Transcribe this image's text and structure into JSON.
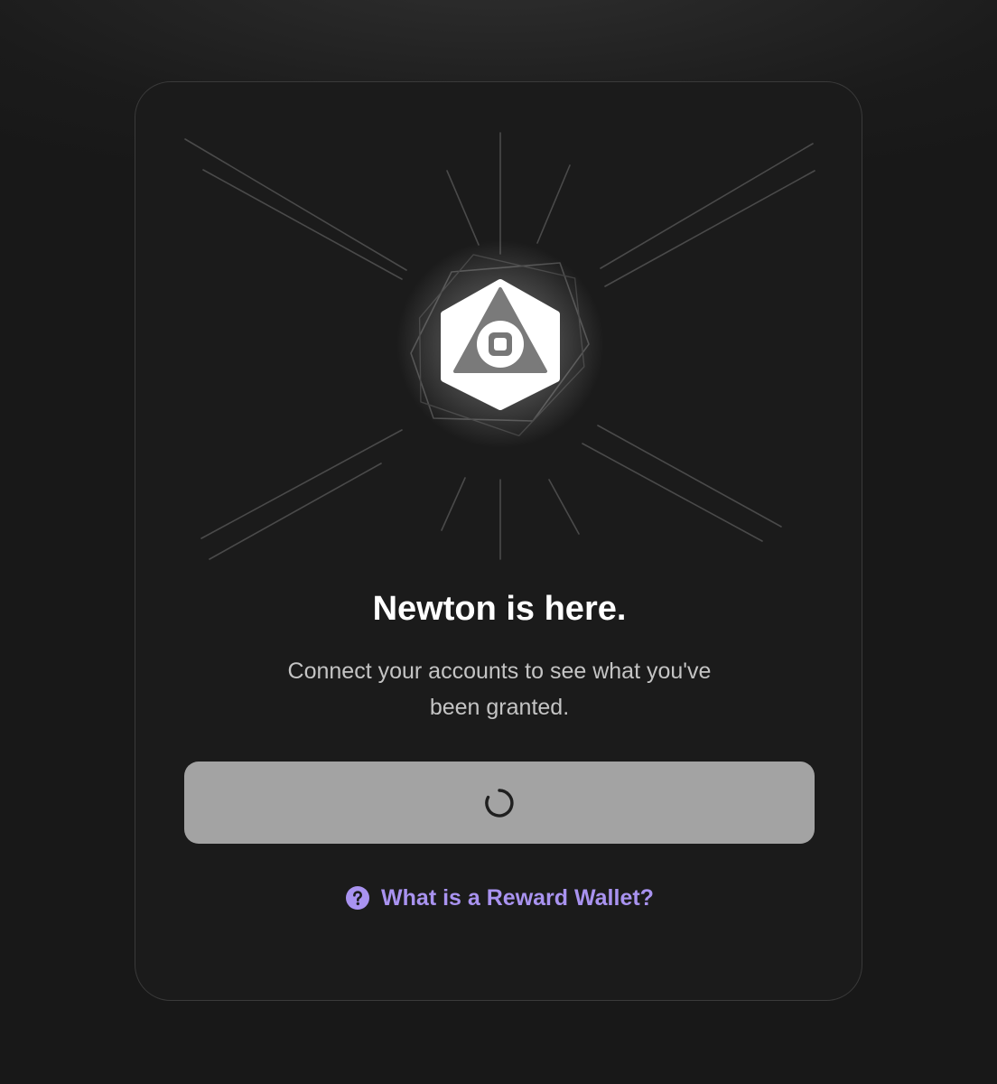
{
  "onboarding": {
    "title": "Newton is here.",
    "subtitle": "Connect your accounts to see what you've been granted.",
    "connect_button": {
      "state": "loading"
    },
    "help_link": {
      "label": "What is a Reward Wallet?",
      "icon": "question-circle-icon"
    },
    "logo_icon": "newton-logo-icon"
  },
  "colors": {
    "background": "#1b1b1b",
    "button_disabled": "#a3a3a3",
    "link_accent": "#a993f0",
    "title_text": "#ffffff",
    "subtitle_text": "#c4c4c4"
  }
}
